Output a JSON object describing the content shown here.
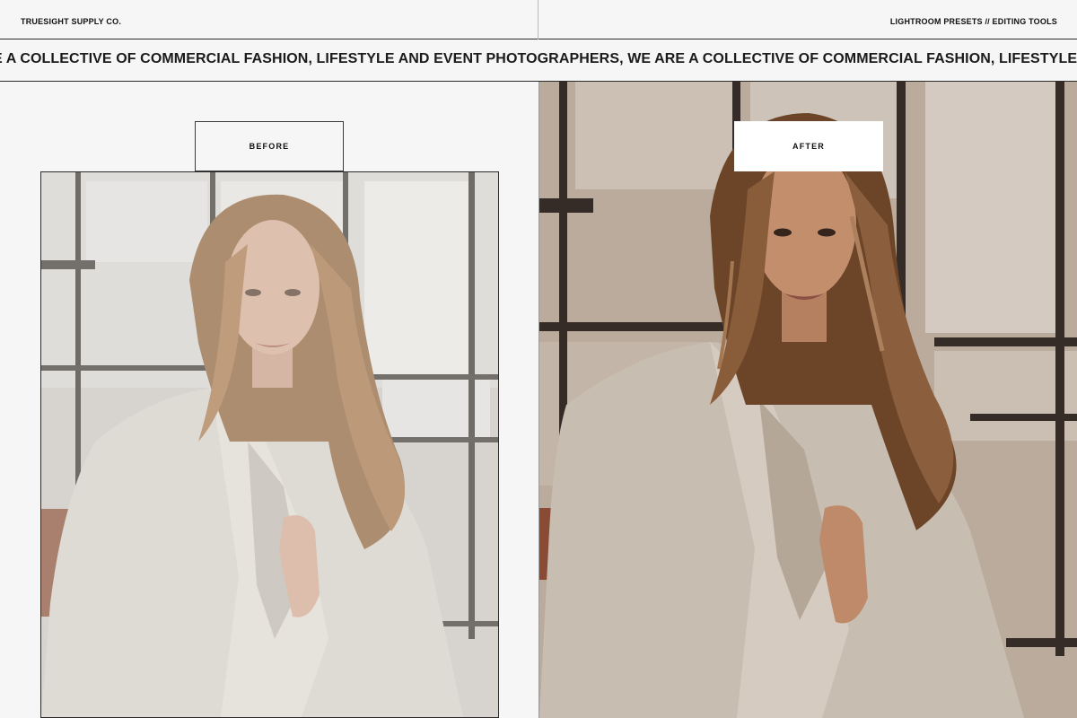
{
  "header": {
    "brand": "TRUESIGHT SUPPLY CO.",
    "tagline": "LIGHTROOM PRESETS // EDITING TOOLS"
  },
  "marquee": {
    "text": "E A COLLECTIVE OF COMMERCIAL FASHION, LIFESTYLE AND EVENT PHOTOGRAPHERS, WE ARE A COLLECTIVE OF COMMERCIAL FASHION, LIFESTYLE AND EVENT PHOTOGRA"
  },
  "comparison": {
    "before_label": "BEFORE",
    "after_label": "AFTER"
  },
  "colors": {
    "page_background": "#f5f6f5",
    "text": "#111111",
    "before_tone": "#cfcac4",
    "after_tone": "#b9ab9c",
    "hair_before": "#a07a58",
    "hair_after": "#6b4428"
  },
  "images": {
    "before_photo": "woman-in-white-blazer-before-edit",
    "after_photo": "woman-in-white-blazer-after-edit"
  }
}
